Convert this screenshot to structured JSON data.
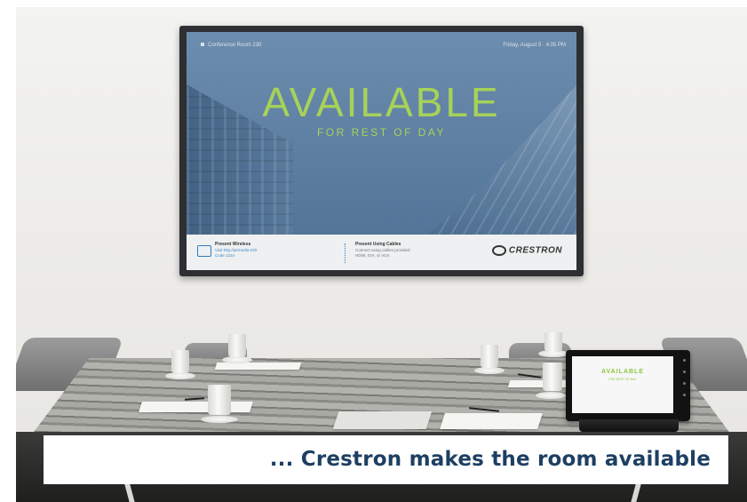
{
  "display": {
    "room_name": "Conference Room 230",
    "datetime": "Friday, August 5 · 4:05 PM",
    "status": "AVAILABLE",
    "substatus": "FOR REST OF DAY",
    "present_wireless": {
      "title": "Present Wireless",
      "line1": "Visit http://airmedia-230",
      "line2": "Code 1234"
    },
    "present_cables": {
      "title": "Present Using Cables",
      "line1": "Connect using cables provided",
      "line2": "HDMI, DVI, or VGA"
    },
    "brand": "CRESTRON"
  },
  "touch_panel": {
    "status": "AVAILABLE",
    "substatus": "FOR REST OF DAY"
  },
  "caption": {
    "text": "... Crestron makes the room available",
    "color": "#1d3f63"
  },
  "colors": {
    "status_green": "#a7d25a",
    "screen_blue": "#5a7c9f"
  }
}
